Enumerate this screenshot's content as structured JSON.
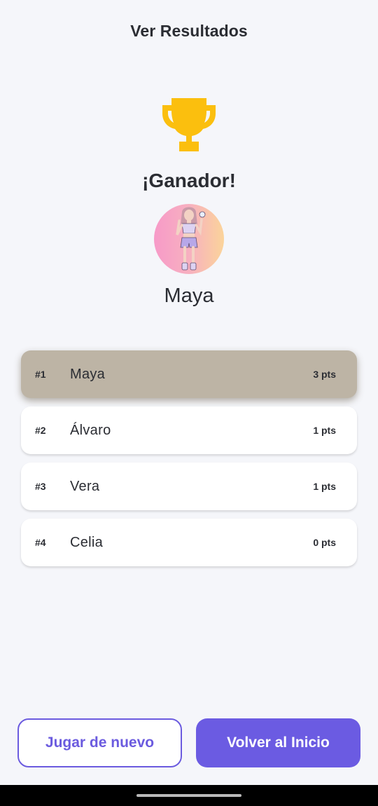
{
  "header": {
    "title": "Ver Resultados"
  },
  "winner": {
    "icon": "trophy-icon",
    "trophy_color": "#fbbf0e",
    "title": "¡Ganador!",
    "name": "Maya"
  },
  "ranking": [
    {
      "position": "#1",
      "name": "Maya",
      "points": "3 pts"
    },
    {
      "position": "#2",
      "name": "Álvaro",
      "points": "1 pts"
    },
    {
      "position": "#3",
      "name": "Vera",
      "points": "1 pts"
    },
    {
      "position": "#4",
      "name": "Celia",
      "points": "0 pts"
    }
  ],
  "actions": {
    "play_again": "Jugar de nuevo",
    "back_home": "Volver al Inicio"
  },
  "colors": {
    "accent": "#6b5be2",
    "winner_row": "#bdb4a5",
    "background": "#f5f6fa"
  }
}
